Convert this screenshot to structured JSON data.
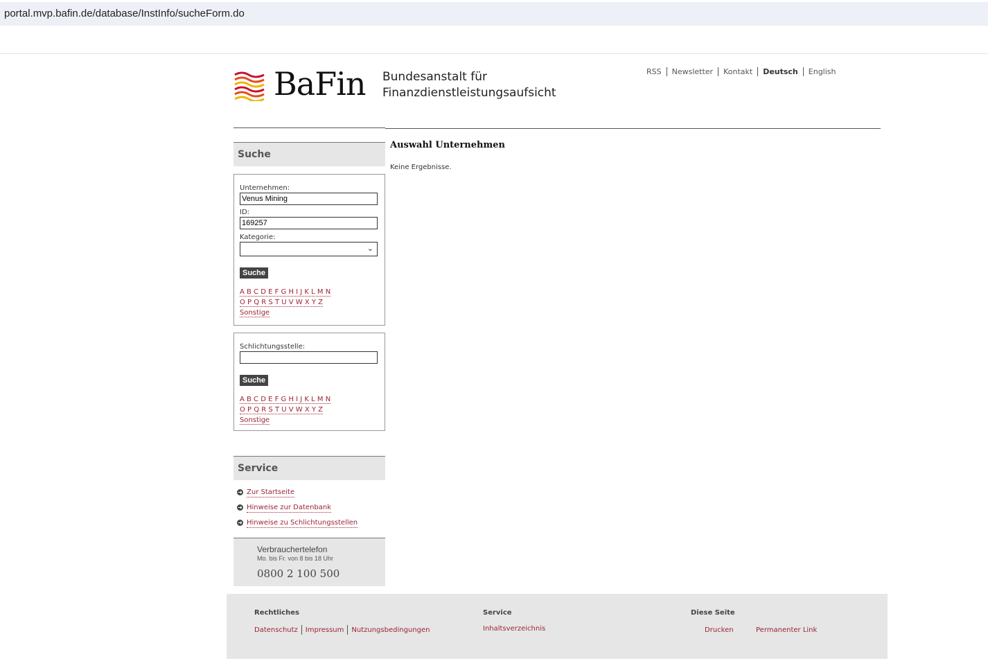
{
  "browser": {
    "url": "portal.mvp.bafin.de/database/InstInfo/sucheForm.do"
  },
  "header": {
    "logo_word": "BaFin",
    "logo_sub_line1": "Bundesanstalt für",
    "logo_sub_line2": "Finanzdienstleistungsaufsicht",
    "nav": [
      "RSS",
      "Newsletter",
      "Kontakt",
      "Deutsch",
      "English"
    ],
    "nav_active": "Deutsch"
  },
  "search": {
    "heading": "Suche",
    "company_label": "Unternehmen:",
    "company_value": "Venus Mining",
    "id_label": "ID:",
    "id_value": "169257",
    "category_label": "Kategorie:",
    "category_value": "",
    "button_label": "Suche",
    "alpha_row1": "A B C D E F G H I J K L M N",
    "alpha_row2": "O P Q R S T U V W X Y Z",
    "alpha_other": "Sonstige"
  },
  "arbitration": {
    "label": "Schlichtungsstelle:",
    "value": "",
    "button_label": "Suche",
    "alpha_row1": "A B C D E F G H I J K L M N",
    "alpha_row2": "O P Q R S T U V W X Y Z",
    "alpha_other": "Sonstige"
  },
  "main": {
    "title": "Auswahl Unternehmen",
    "result_text": "Keine Ergebnisse."
  },
  "service": {
    "heading": "Service",
    "links": [
      "Zur Startseite",
      "Hinweise zur Datenbank",
      "Hinweise zu Schlichtungsstellen"
    ],
    "phone_title": "Verbrauchertelefon",
    "phone_hours": "Mo. bis Fr. von 8 bis 18 Uhr",
    "phone_number": "0800 2 100 500"
  },
  "footer": {
    "legal_heading": "Rechtliches",
    "legal_links": [
      "Datenschutz",
      "Impressum",
      "Nutzungsbedingungen"
    ],
    "service_heading": "Service",
    "service_link": "Inhaltsverzeichnis",
    "page_heading": "Diese Seite",
    "page_links": [
      "Drucken",
      "Permanenter Link"
    ]
  },
  "colors": {
    "link": "#9b2335",
    "panel_bg": "#e6e6e6",
    "logo_red": "#c8102e",
    "logo_gold": "#f0b400"
  },
  "icons": [
    "bafin-logo-waves",
    "chevron-down-icon",
    "arrow-circle-icon"
  ]
}
